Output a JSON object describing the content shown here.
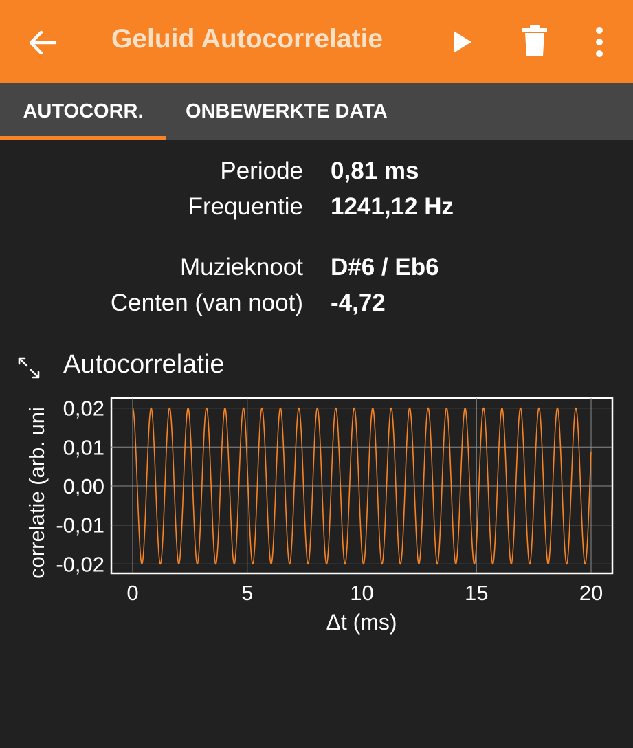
{
  "app_bar": {
    "title": "Geluid Autocorrelatie",
    "back_icon": "arrow-left-icon",
    "play_icon": "play-icon",
    "delete_icon": "trash-icon",
    "more_icon": "more-vertical-icon",
    "background_color": "#f78324"
  },
  "tabs": [
    {
      "label": "AUTOCORR.",
      "selected": true
    },
    {
      "label": "ONBEWERKTE DATA",
      "selected": false
    }
  ],
  "values": [
    {
      "label": "Periode",
      "value": "0,81 ms"
    },
    {
      "label": "Frequentie",
      "value": "1241,12 Hz"
    },
    {
      "label": "Muzieknoot",
      "value": "D#6 / Eb6"
    },
    {
      "label": "Centen (van noot)",
      "value": "-4,72"
    }
  ],
  "graph": {
    "title": "Autocorrelatie",
    "expand_icon": "expand-arrows-icon",
    "line_color": "#f78324"
  },
  "chart_data": {
    "type": "line",
    "xlabel": "Δt (ms)",
    "ylabel": "correlatie (arb. uni",
    "xlim": [
      0,
      20
    ],
    "ylim": [
      -0.021,
      0.021
    ],
    "xticks": [
      0,
      5,
      10,
      15,
      20
    ],
    "xtick_labels": [
      "0",
      "5",
      "10",
      "15",
      "20"
    ],
    "yticks": [
      0.02,
      0.01,
      0.0,
      -0.01,
      -0.02
    ],
    "ytick_labels": [
      "0,02",
      "0,01",
      "0,00",
      "-0,01",
      "-0,02"
    ],
    "grid": true,
    "series": [
      {
        "period_ms": 0.8057,
        "amplitude": 0.02,
        "x_start": 0,
        "x_end": 20,
        "shape": "cosine"
      }
    ]
  }
}
